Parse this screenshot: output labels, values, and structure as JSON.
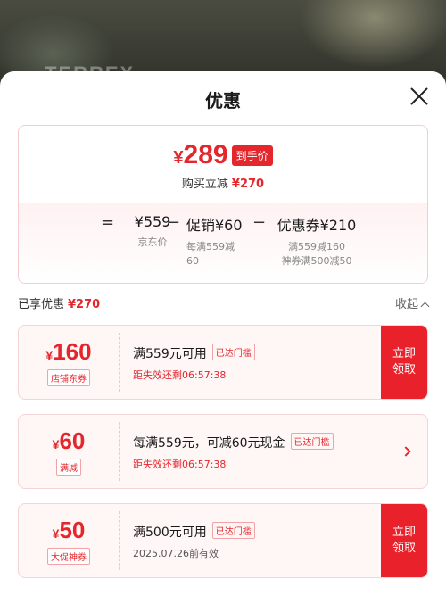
{
  "backdrop": {
    "brand_mark": "TERREX"
  },
  "sheet": {
    "title": "优惠"
  },
  "price": {
    "final_yen": "¥",
    "final_value": "289",
    "badge": "到手价",
    "save_label": "购买立减",
    "save_amount": "¥270"
  },
  "formula": {
    "eq": "=",
    "minus": "−",
    "items": [
      {
        "value": "¥559",
        "sub1": "京东价",
        "sub2": ""
      },
      {
        "value": "促销¥60",
        "sub1": "每满559减",
        "sub2": "60"
      },
      {
        "value": "优惠券¥210",
        "sub1": "满559减160",
        "sub2": "神券满500减50"
      }
    ]
  },
  "summary": {
    "label": "已享优惠",
    "amount": "¥270",
    "collapse": "收起"
  },
  "coupons": [
    {
      "yen": "¥",
      "amount": "160",
      "type": "店铺东券",
      "desc": "满559元可用",
      "met": "已达门槛",
      "line2": "距失效还剩06:57:38",
      "action": "立即领取"
    },
    {
      "yen": "¥",
      "amount": "60",
      "type": "满减",
      "desc": "每满559元，可减60元现金",
      "met": "已达门槛",
      "line2": "距失效还剩06:57:38"
    },
    {
      "yen": "¥",
      "amount": "50",
      "type": "大促神券",
      "desc": "满500元可用",
      "met": "已达门槛",
      "line2": "2025.07.26前有效",
      "action": "立即领取"
    }
  ],
  "colors": {
    "accent": "#e4262d",
    "coupon_bg": "#fff6f6",
    "border": "#f4cdd0"
  }
}
